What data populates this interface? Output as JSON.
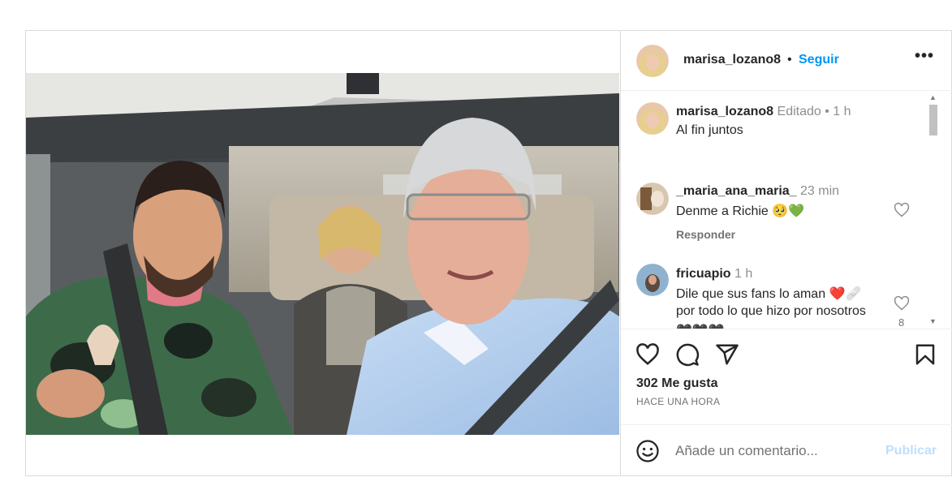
{
  "post": {
    "author": "marisa_lozano8",
    "follow_label": "Seguir",
    "separator": "•",
    "more_label": "•••"
  },
  "caption": {
    "username": "marisa_lozano8",
    "edited": "Editado",
    "time": "1 h",
    "text": "Al fin juntos"
  },
  "comments": [
    {
      "username": "_maria_ana_maria_",
      "time": "23 min",
      "text": "Denme a Richie 🥺💚",
      "reply_label": "Responder"
    },
    {
      "username": "fricuapio",
      "time": "1 h",
      "text_line1": "Dile que sus fans lo aman ❤️🩹",
      "text_line2": "por todo lo que hizo por nosotros",
      "text_line3": "🖤🖤🖤",
      "like_count": "8"
    }
  ],
  "engagement": {
    "likes": "302 Me gusta",
    "time_ago": "HACE UNA HORA"
  },
  "add_comment": {
    "placeholder": "Añade un comentario...",
    "publish_label": "Publicar"
  },
  "colors": {
    "follow_blue": "#0095f6",
    "publish_disabled": "#c0dffd",
    "heart_red": "#ed4956"
  },
  "icons": {
    "like": "heart-icon",
    "comment": "comment-icon",
    "share": "share-icon",
    "save": "bookmark-icon",
    "emoji": "smiley-icon",
    "more": "more-options-icon"
  }
}
